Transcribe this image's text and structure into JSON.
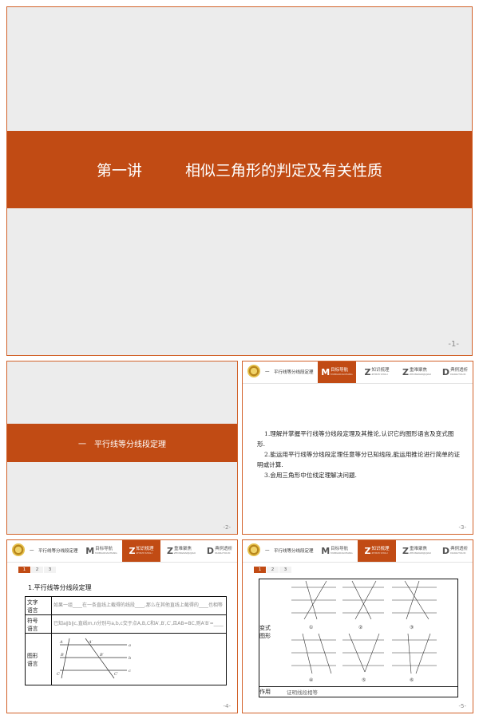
{
  "slides": [
    {
      "title_part1": "第一讲",
      "title_part2": "相似三角形的判定及有关性质",
      "page": "-1-"
    },
    {
      "title": "一　平行线等分线段定理",
      "page": "-2-"
    },
    {
      "header": "一　平行线等分线段定理",
      "objectives": [
        "1.理解并掌握平行线等分线段定理及其推论,认识它的图形语言及变式图形.",
        "2.能运用平行线等分线段定理任意等分已知线段,能运用推论进行简单的证明或计算.",
        "3.会用三角形中位线定理解决问题."
      ],
      "page": "-3-"
    },
    {
      "header": "一　平行线等分线段定理",
      "section_title": "1.平行线等分线段定理",
      "rows": [
        {
          "head": "文字\n语言",
          "content": "如果一组____在一条直线上截得的线段____,那么在其他直线上截得的____也相等"
        },
        {
          "head": "符号\n语言",
          "content": "已知a∥b∥c,直线m,n分别与a,b,c交于点A,B,C和A′,B′,C′,且AB=BC,则A′B′=____"
        },
        {
          "head": "图形\n语言",
          "content": ""
        }
      ],
      "page": "-4-"
    },
    {
      "header": "一　平行线等分线段定理",
      "row_label_variant": "变式\n图形",
      "row_label_use": "作用",
      "use_text": "证明线段相等",
      "fig_labels": [
        "①",
        "②",
        "③",
        "④",
        "⑤",
        "⑥"
      ],
      "page": "-5-"
    }
  ],
  "tabs": [
    {
      "letter": "M",
      "label": "目标导航",
      "sub": "MUBIAODAOHANG"
    },
    {
      "letter": "Z",
      "label": "知识梳理",
      "sub": "ZHISHI SHULI"
    },
    {
      "letter": "Z",
      "label": "重难聚焦",
      "sub": "ZHONGNANJUJIAO"
    },
    {
      "letter": "D",
      "label": "典例透析",
      "sub": "DIANLITOUXI"
    }
  ],
  "pager": [
    "1",
    "2",
    "3"
  ],
  "colors": {
    "accent": "#c14b14",
    "slide_bg": "#ececec",
    "border": "#d2622a"
  }
}
